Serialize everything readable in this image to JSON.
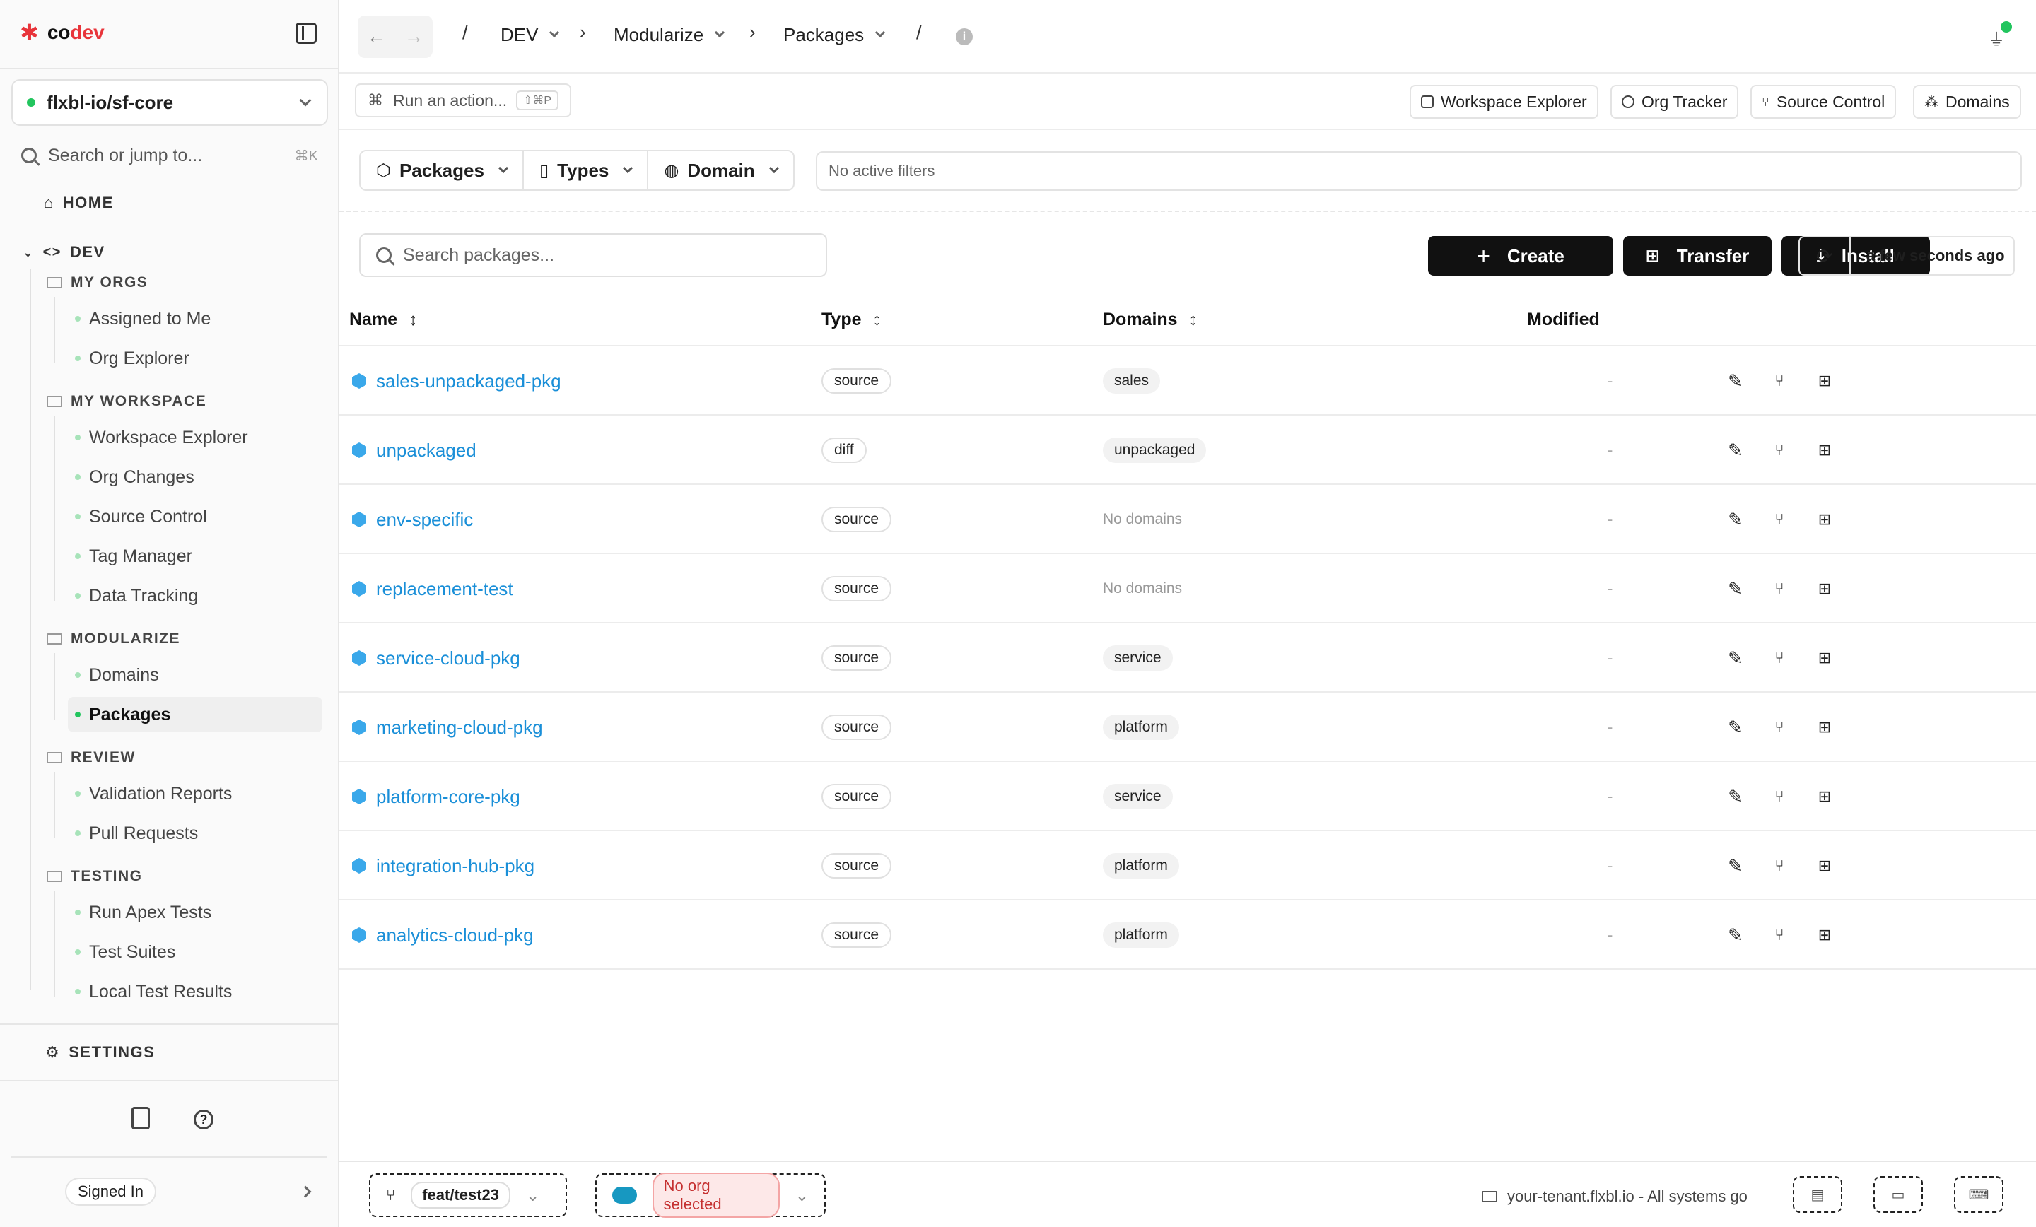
{
  "brand": {
    "name_prefix": "co",
    "name_suffix": "dev"
  },
  "org_selector": {
    "value": "flxbl-io/sf-core"
  },
  "search": {
    "placeholder": "Search or jump to...",
    "shortcut": "⌘K"
  },
  "sidebar": {
    "home": "HOME",
    "dev": "DEV",
    "groups": [
      {
        "label": "MY ORGS",
        "items": [
          "Assigned to Me",
          "Org Explorer"
        ]
      },
      {
        "label": "MY WORKSPACE",
        "items": [
          "Workspace Explorer",
          "Org Changes",
          "Source Control",
          "Tag Manager",
          "Data Tracking"
        ]
      },
      {
        "label": "MODULARIZE",
        "items": [
          "Domains",
          "Packages"
        ]
      },
      {
        "label": "REVIEW",
        "items": [
          "Validation Reports",
          "Pull Requests"
        ]
      },
      {
        "label": "TESTING",
        "items": [
          "Run Apex Tests",
          "Test Suites",
          "Local Test Results"
        ]
      }
    ],
    "active_item": "Packages",
    "settings": "SETTINGS",
    "signed_in": "Signed In"
  },
  "breadcrumb": {
    "items": [
      "DEV",
      "Modularize",
      "Packages"
    ],
    "info": "i"
  },
  "action_bar": {
    "run_action": "Run an action...",
    "run_shortcut": "⇧⌘P",
    "tools": [
      "Workspace Explorer",
      "Org Tracker",
      "Source Control",
      "Domains"
    ]
  },
  "filters": {
    "segments": [
      "Packages",
      "Types",
      "Domain"
    ],
    "active_filters": "No active filters"
  },
  "toolbar": {
    "search_placeholder": "Search packages...",
    "create": "Create",
    "transfer": "Transfer",
    "install": "Install",
    "refreshed": "a few seconds ago"
  },
  "table": {
    "columns": [
      "Name",
      "Type",
      "Domains",
      "Modified"
    ],
    "rows": [
      {
        "name": "sales-unpackaged-pkg",
        "type": "source",
        "domain": "sales",
        "modified": "-"
      },
      {
        "name": "unpackaged",
        "type": "diff",
        "domain": "unpackaged",
        "modified": "-"
      },
      {
        "name": "env-specific",
        "type": "source",
        "domain": "No domains",
        "modified": "-"
      },
      {
        "name": "replacement-test",
        "type": "source",
        "domain": "No domains",
        "modified": "-"
      },
      {
        "name": "service-cloud-pkg",
        "type": "source",
        "domain": "service",
        "modified": "-"
      },
      {
        "name": "marketing-cloud-pkg",
        "type": "source",
        "domain": "platform",
        "modified": "-"
      },
      {
        "name": "platform-core-pkg",
        "type": "source",
        "domain": "service",
        "modified": "-"
      },
      {
        "name": "integration-hub-pkg",
        "type": "source",
        "domain": "platform",
        "modified": "-"
      },
      {
        "name": "analytics-cloud-pkg",
        "type": "source",
        "domain": "platform",
        "modified": "-"
      }
    ]
  },
  "bottom_bar": {
    "branch": "feat/test23",
    "org_status": "No org selected",
    "tenant": "your-tenant.flxbl.io - All systems go"
  },
  "colors": {
    "accent_link": "#1a8fd8",
    "brand_red": "#e8343a",
    "status_green": "#22c55e",
    "button_dark": "#111111"
  }
}
